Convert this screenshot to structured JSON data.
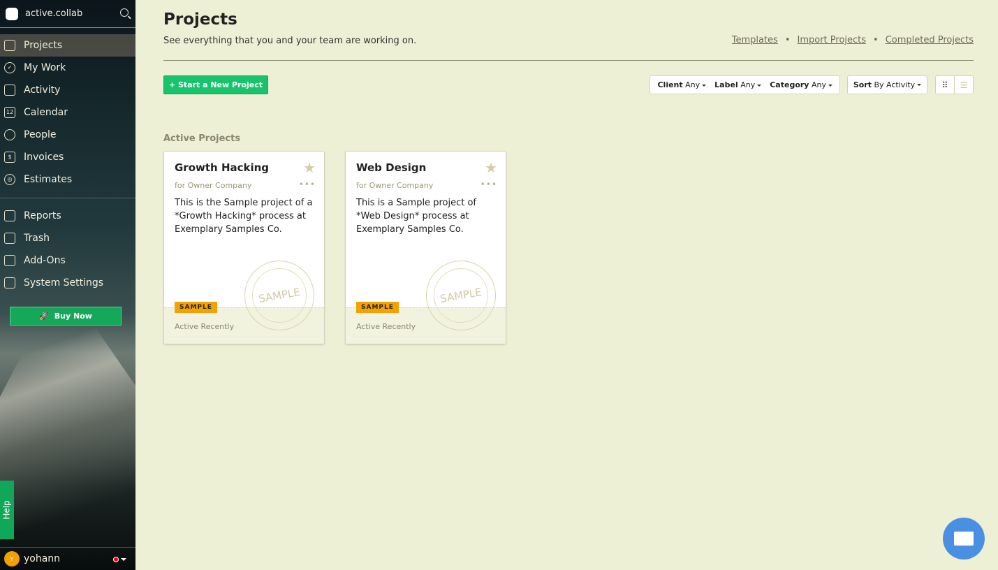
{
  "app": {
    "name": "active.collab"
  },
  "sidebar": {
    "items": [
      {
        "label": "Projects",
        "icon": "archive-icon",
        "active": true
      },
      {
        "label": "My Work",
        "icon": "check-circle-icon"
      },
      {
        "label": "Activity",
        "icon": "activity-icon"
      },
      {
        "label": "Calendar",
        "icon": "calendar-icon",
        "icon_text": "12"
      },
      {
        "label": "People",
        "icon": "people-icon"
      },
      {
        "label": "Invoices",
        "icon": "dollar-icon",
        "icon_text": "$"
      },
      {
        "label": "Estimates",
        "icon": "target-icon"
      }
    ],
    "items2": [
      {
        "label": "Reports",
        "icon": "reports-icon"
      },
      {
        "label": "Trash",
        "icon": "trash-icon"
      },
      {
        "label": "Add-Ons",
        "icon": "addons-icon"
      },
      {
        "label": "System Settings",
        "icon": "settings-icon"
      }
    ],
    "buy_now": "Buy Now",
    "help": "Help",
    "user": {
      "name": "yohann",
      "initial": "Y",
      "status_color": "#e00000"
    }
  },
  "header": {
    "title": "Projects",
    "subtitle": "See everything that you and your team are working on.",
    "links": [
      "Templates",
      "Import Projects",
      "Completed Projects"
    ]
  },
  "toolbar": {
    "new_project": "+ Start a New Project",
    "filters": [
      {
        "label": "Client",
        "value": "Any"
      },
      {
        "label": "Label",
        "value": "Any"
      },
      {
        "label": "Category",
        "value": "Any"
      }
    ],
    "sort": {
      "label": "Sort",
      "value": "By Activity"
    }
  },
  "section_title": "Active Projects",
  "projects": [
    {
      "title": "Growth Hacking",
      "client": "for Owner Company",
      "description": "This is the Sample project of a *Growth Hacking* process at Exemplary Samples Co.",
      "badge": "SAMPLE",
      "activity": "Active Recently",
      "stamp": "SAMPLE"
    },
    {
      "title": "Web Design",
      "client": "for Owner Company",
      "description": "This is a Sample project of *Web Design* process at Exemplary Samples Co.",
      "badge": "SAMPLE",
      "activity": "Active Recently",
      "stamp": "SAMPLE"
    }
  ],
  "colors": {
    "accent": "#18c46b",
    "badge": "#f5a200",
    "chat": "#4a90e2"
  }
}
